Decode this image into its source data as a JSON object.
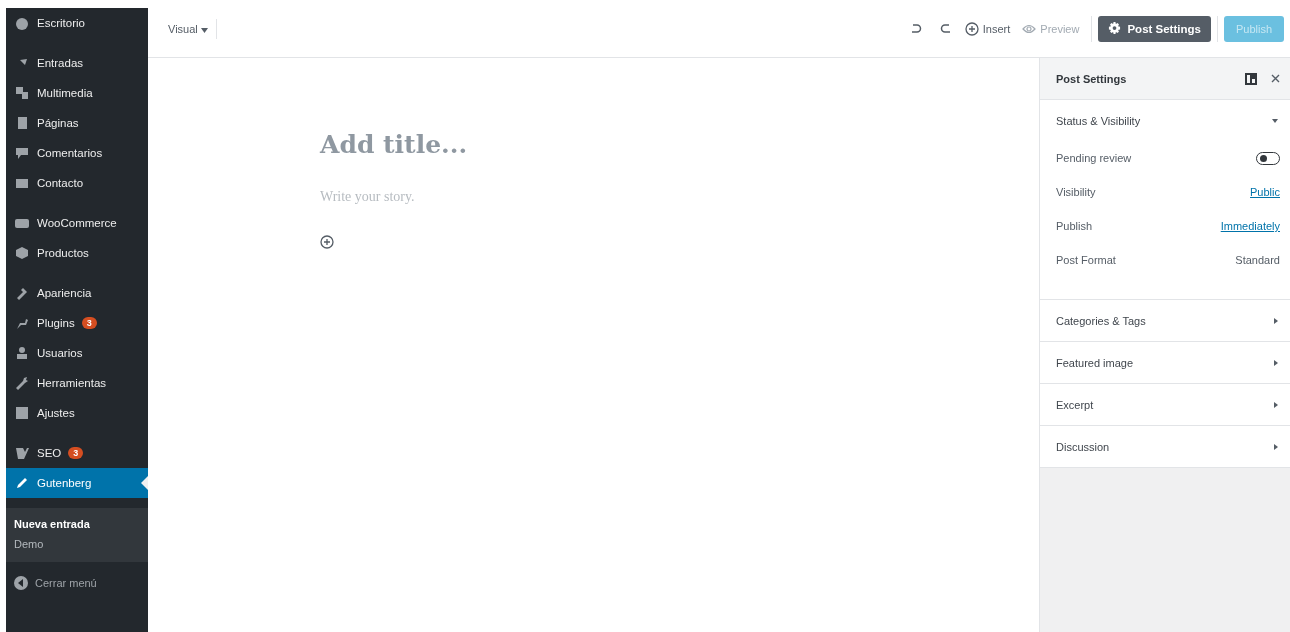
{
  "sidebar": {
    "menu_groups": [
      {
        "items": [
          {
            "label": "Escritorio",
            "selected": false
          }
        ]
      },
      {
        "items": [
          {
            "label": "Entradas",
            "selected": false
          },
          {
            "label": "Multimedia",
            "selected": false
          },
          {
            "label": "Páginas",
            "selected": false
          },
          {
            "label": "Comentarios",
            "selected": false
          },
          {
            "label": "Contacto",
            "selected": false
          }
        ]
      },
      {
        "items": [
          {
            "label": "WooCommerce",
            "selected": false
          },
          {
            "label": "Productos",
            "selected": false
          }
        ]
      },
      {
        "items": [
          {
            "label": "Apariencia",
            "selected": false
          },
          {
            "label": "Plugins",
            "badge": "3",
            "selected": false
          },
          {
            "label": "Usuarios",
            "selected": false
          },
          {
            "label": "Herramientas",
            "selected": false
          },
          {
            "label": "Ajustes",
            "selected": false
          }
        ]
      },
      {
        "items": [
          {
            "label": "SEO",
            "badge": "3",
            "selected": false
          },
          {
            "label": "Gutenberg",
            "selected": true
          }
        ]
      }
    ],
    "submenu": [
      {
        "label": "Nueva entrada",
        "selected": true
      },
      {
        "label": "Demo",
        "selected": false
      }
    ],
    "collapse": "Cerrar menú"
  },
  "toolbar": {
    "mode": "Visual",
    "insert": "Insert",
    "preview": {
      "label": "Preview",
      "disabled": true
    },
    "settings": {
      "label": "Post Settings",
      "active": true
    },
    "publish": {
      "label": "Publish",
      "disabled": true
    }
  },
  "editor": {
    "title_placeholder": "Add title...",
    "body_placeholder": "Write your story."
  },
  "panel": {
    "title": "Post Settings",
    "sections": [
      {
        "title": "Status & Visibility",
        "expanded": true,
        "rows": [
          {
            "kind": "toggle",
            "label": "Pending review",
            "on": false
          },
          {
            "kind": "link",
            "label": "Visibility",
            "value": "Public"
          },
          {
            "kind": "link",
            "label": "Publish",
            "value": "Immediately"
          },
          {
            "kind": "text",
            "label": "Post Format",
            "value": "Standard"
          }
        ]
      },
      {
        "title": "Categories & Tags",
        "expanded": false
      },
      {
        "title": "Featured image",
        "expanded": false
      },
      {
        "title": "Excerpt",
        "expanded": false
      },
      {
        "title": "Discussion",
        "expanded": false
      }
    ]
  }
}
